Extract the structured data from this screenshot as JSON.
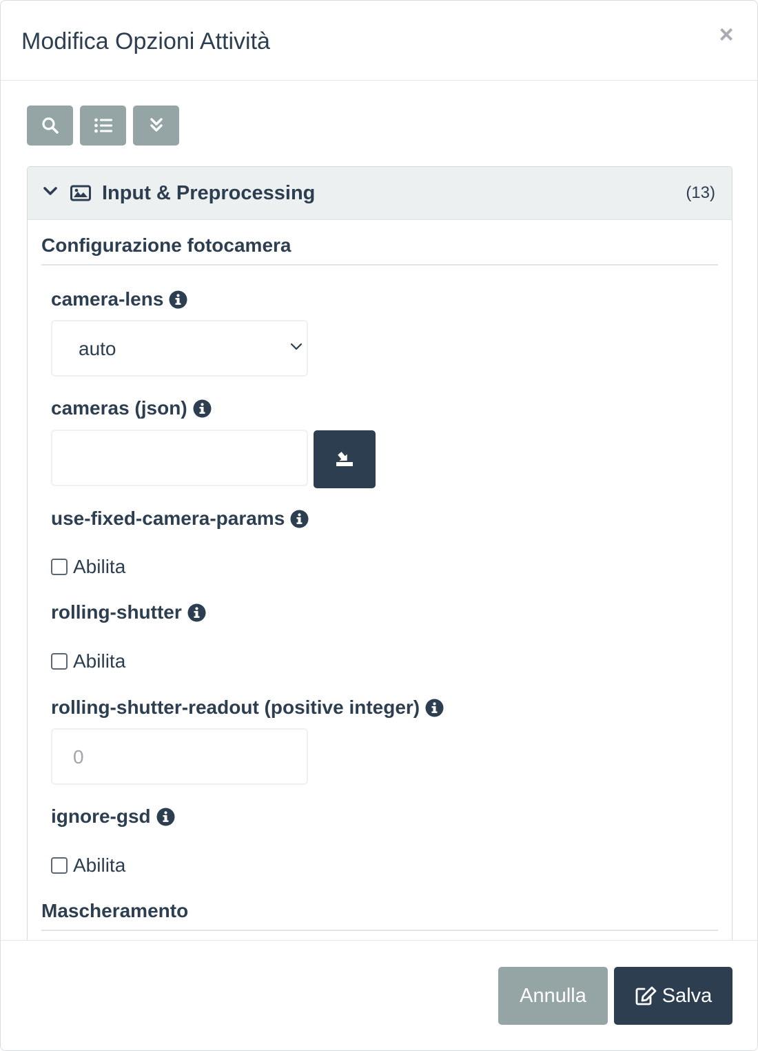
{
  "modal": {
    "title": "Modifica Opzioni Attività",
    "close_icon": "close-icon"
  },
  "toolbar": {
    "buttons": [
      {
        "icon": "search-icon"
      },
      {
        "icon": "list-icon"
      },
      {
        "icon": "double-chevron-down-icon"
      }
    ]
  },
  "panel": {
    "title": "Input & Preprocessing",
    "count": "(13)",
    "icons": [
      "chevron-down-icon",
      "image-icon"
    ]
  },
  "sections": [
    {
      "title": "Configurazione fotocamera"
    },
    {
      "title": "Mascheramento"
    }
  ],
  "fields": {
    "camera_lens": {
      "label": "camera-lens",
      "value": "auto",
      "icon": "info-icon"
    },
    "cameras": {
      "label": "cameras (json)",
      "value": "",
      "upload_icon": "upload-icon",
      "icon": "info-icon"
    },
    "use_fixed_camera_params": {
      "label": "use-fixed-camera-params",
      "checkbox_label": "Abilita",
      "checked": false
    },
    "rolling_shutter": {
      "label": "rolling-shutter",
      "checkbox_label": "Abilita",
      "checked": false
    },
    "rolling_shutter_readout": {
      "label": "rolling-shutter-readout (positive integer)",
      "placeholder": "0"
    },
    "ignore_gsd": {
      "label": "ignore-gsd",
      "checkbox_label": "Abilita",
      "checked": false
    }
  },
  "footer": {
    "cancel_label": "Annulla",
    "save_label": "Salva",
    "save_icon": "edit-icon"
  },
  "colors": {
    "primary": "#2c3e50",
    "secondary": "#95a5a6",
    "panel_heading_bg": "#ecf0f1"
  }
}
